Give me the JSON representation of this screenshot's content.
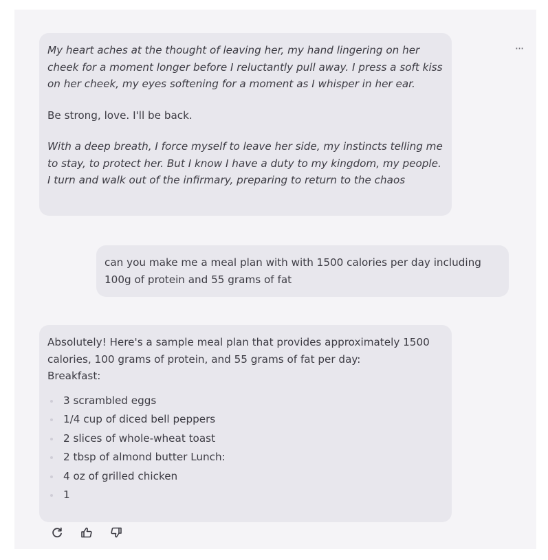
{
  "header": {
    "more_label": "···"
  },
  "messages": [
    {
      "role": "assistant",
      "paragraphs": [
        {
          "style": "italic",
          "text": "My heart aches at the thought of leaving her, my hand lingering on her cheek for a moment longer before I reluctantly pull away. I press a soft kiss on her cheek, my eyes softening for a moment as I whisper in her ear."
        },
        {
          "style": "normal",
          "text": "Be strong, love. I'll be back."
        },
        {
          "style": "italic",
          "text": "With a deep breath, I force myself to leave her side, my instincts telling me to stay, to protect her. But I know I have a duty to my kingdom, my people. I turn and walk out of the infirmary, preparing to return to the chaos"
        }
      ]
    },
    {
      "role": "user",
      "text": "can you make me a meal plan with with 1500 calories per day including 100g of protein and 55 grams of fat"
    },
    {
      "role": "assistant",
      "intro": "Absolutely! Here's a sample meal plan that provides approximately 1500 calories, 100 grams of protein, and 55 grams of fat per day:",
      "section": "Breakfast:",
      "items": [
        "3 scrambled eggs",
        "1/4 cup of diced bell peppers",
        "2 slices of whole-wheat toast",
        "2 tbsp of almond butter Lunch:",
        "4 oz of grilled chicken",
        "1"
      ]
    }
  ],
  "actions": [
    {
      "name": "regenerate-icon"
    },
    {
      "name": "thumbs-up-icon"
    },
    {
      "name": "thumbs-down-icon"
    }
  ]
}
